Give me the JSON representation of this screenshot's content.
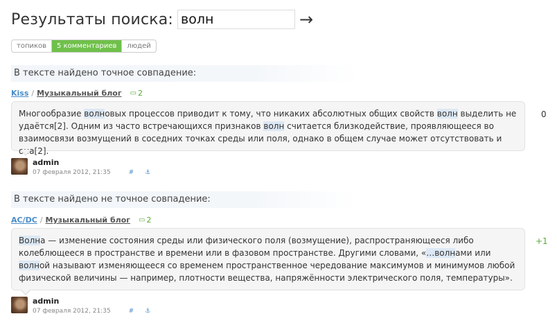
{
  "header": {
    "title": "Результаты поиска:",
    "search_value": "волн",
    "go_icon": "arrow-right-icon",
    "go_symbol": "→"
  },
  "tabs": [
    {
      "label": "топиков",
      "active": false
    },
    {
      "label": "5 комментариев",
      "active": true
    },
    {
      "label": "людей",
      "active": false
    }
  ],
  "results": [
    {
      "heading": "В тексте найдено точное совпадение:",
      "user": "Kiss",
      "separator": "/",
      "blog": "Музыкальный блог",
      "comment_icon": "💬",
      "comments": "2",
      "score": "0",
      "score_color": "#333333",
      "text_parts": [
        {
          "t": "Многообразие ",
          "hl": false
        },
        {
          "t": "волн",
          "hl": true
        },
        {
          "t": "овых процессов приводит к тому, что никаких абсолютных общих свойств ",
          "hl": false
        },
        {
          "t": "волн",
          "hl": true
        },
        {
          "t": " выделить не удаётся[2]. Одним из часто встречающихся признаков ",
          "hl": false
        },
        {
          "t": "волн",
          "hl": true
        },
        {
          "t": " считается близкодействие, проявляющееся во взаимосвязи возмущений в соседних точках среды или поля, однако в общем случае может отсутствовать и она[2].",
          "hl": false
        }
      ],
      "author": "admin",
      "date": "07 февраля 2012, 21:35",
      "anchor_symbol": "#",
      "fav_symbol": "⚓"
    },
    {
      "heading": "В тексте найдено не точное совпадение:",
      "user": "AC/DC",
      "separator": "/",
      "blog": "Музыкальный блог",
      "comment_icon": "💬",
      "comments": "2",
      "score": "+1",
      "score_color": "#56a83a",
      "text_parts": [
        {
          "t": "Волн",
          "hl": true
        },
        {
          "t": "а — изменение состояния среды или физического поля (возмущение), распространяющееся либо колеблющееся в пространстве и времени или в фазовом пространстве. Другими словами, «",
          "hl": false
        },
        {
          "t": "…волн",
          "hl": true
        },
        {
          "t": "ами или ",
          "hl": false
        },
        {
          "t": "волн",
          "hl": true
        },
        {
          "t": "ой называют изменяющееся со временем пространственное чередование максимумов и минимумов любой физической величины — например, плотности вещества, напряжённости электрического поля, температуры».",
          "hl": false
        }
      ],
      "author": "admin",
      "date": "07 февраля 2012, 21:35",
      "anchor_symbol": "#",
      "fav_symbol": "⚓"
    }
  ]
}
